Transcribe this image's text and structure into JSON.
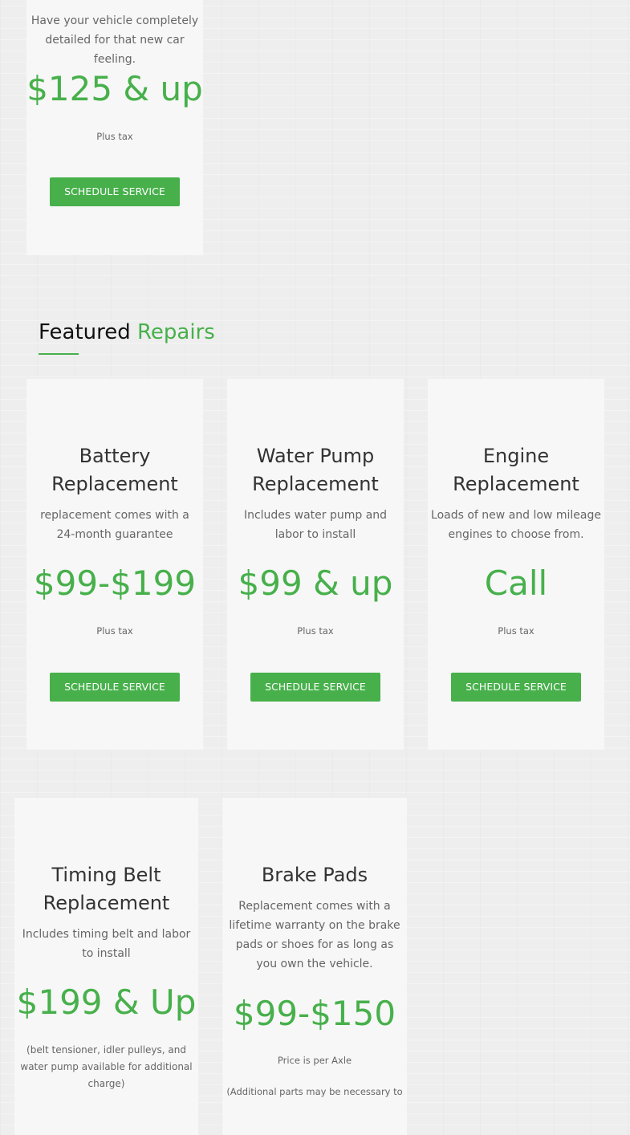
{
  "section": {
    "heading_main": "Featured",
    "heading_accent": "Repairs"
  },
  "cards": {
    "detailing": {
      "description": "Have your vehicle completely detailed for that new car feeling.",
      "price": "$125 & up",
      "note": "Plus tax",
      "button": "SCHEDULE SERVICE"
    },
    "battery": {
      "title_line1": "Battery",
      "title_line2": "Replacement",
      "description": "replacement comes with a 24-month guarantee",
      "price": "$99-$199",
      "note": "Plus tax",
      "button": "SCHEDULE SERVICE"
    },
    "water_pump": {
      "title_line1": "Water Pump",
      "title_line2": "Replacement",
      "description": "Includes water pump and labor to install",
      "price": "$99 & up",
      "note": "Plus tax",
      "button": "SCHEDULE SERVICE"
    },
    "engine": {
      "title_line1": "Engine",
      "title_line2": "Replacement",
      "description": "Loads of new and low mileage engines to choose from.",
      "price": "Call",
      "note": "Plus tax",
      "button": "SCHEDULE SERVICE"
    },
    "timing_belt": {
      "title_line1": "Timing Belt",
      "title_line2": "Replacement",
      "description": "Includes timing belt and labor to install",
      "price": "$199 & Up",
      "note": "(belt tensioner, idler pulleys, and water pump available for additional charge)"
    },
    "brake_pads": {
      "title": "Brake Pads",
      "description": "Replacement comes with a lifetime warranty on the brake pads or shoes for as long as you own the vehicle.",
      "price": "$99-$150",
      "note": "Price is per Axle",
      "note2": "(Additional parts may be necessary to"
    }
  }
}
